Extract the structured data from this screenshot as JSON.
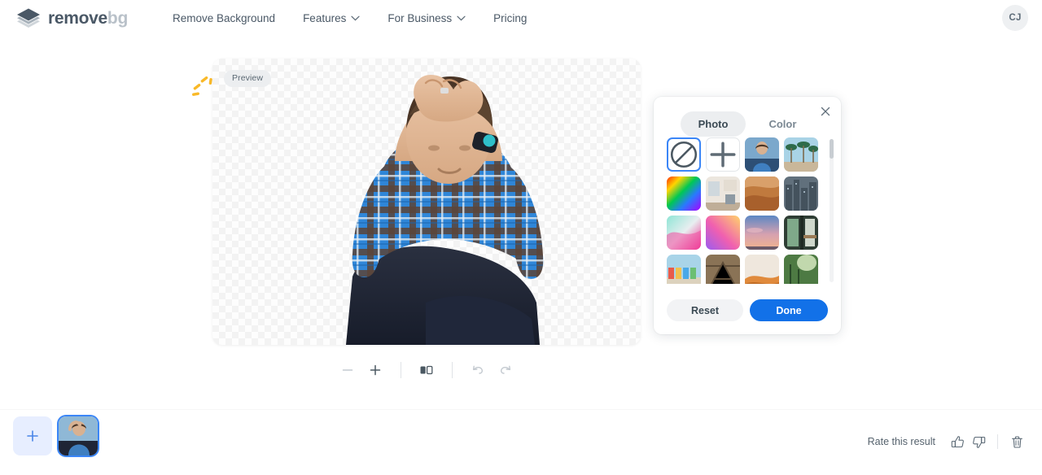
{
  "header": {
    "logo": {
      "icon": "layers-diamond-logo",
      "text_primary": "remove",
      "text_secondary": "bg"
    },
    "nav": [
      {
        "label": "Remove Background",
        "has_chevron": false,
        "icon": ""
      },
      {
        "label": "Features",
        "has_chevron": true,
        "icon": "chevron-down-icon"
      },
      {
        "label": "For Business",
        "has_chevron": true,
        "icon": "chevron-down-icon"
      },
      {
        "label": "Pricing",
        "has_chevron": false,
        "icon": ""
      }
    ],
    "avatar_initials": "CJ"
  },
  "canvas": {
    "preview_badge": "Preview",
    "sparkle_icon": "sparkle-decoration",
    "subject_alt": "man-sitting-hands-on-head-plaid-shirt"
  },
  "toolbar": {
    "zoom_out": {
      "icon": "minus-icon",
      "label": "Zoom out",
      "disabled": true
    },
    "zoom_in": {
      "icon": "plus-icon",
      "label": "Zoom in",
      "disabled": false
    },
    "compare": {
      "icon": "split-compare-icon",
      "label": "Compare",
      "disabled": false
    },
    "undo": {
      "icon": "undo-icon",
      "label": "Undo",
      "disabled": true
    },
    "redo": {
      "icon": "redo-icon",
      "label": "Redo",
      "disabled": true
    }
  },
  "background_panel": {
    "close_icon": "close-icon",
    "tabs": [
      {
        "label": "Photo",
        "active": true
      },
      {
        "label": "Color",
        "active": false
      }
    ],
    "thumbnails": [
      {
        "kind": "none",
        "name": "no-background",
        "icon": "no-background-icon"
      },
      {
        "kind": "add",
        "name": "upload-background",
        "icon": "plus-icon"
      },
      {
        "kind": "photo",
        "name": "photo-man-portrait"
      },
      {
        "kind": "photo",
        "name": "photo-palm-trees"
      },
      {
        "kind": "gradient",
        "name": "gradient-rainbow"
      },
      {
        "kind": "photo",
        "name": "photo-interior-room"
      },
      {
        "kind": "photo",
        "name": "photo-desert-dunes"
      },
      {
        "kind": "photo",
        "name": "photo-city-skyline"
      },
      {
        "kind": "gradient",
        "name": "gradient-teal-pink"
      },
      {
        "kind": "gradient",
        "name": "gradient-purple-yellow"
      },
      {
        "kind": "photo",
        "name": "photo-sunset-sky"
      },
      {
        "kind": "photo",
        "name": "photo-balcony-window"
      },
      {
        "kind": "photo",
        "name": "photo-beach-huts"
      },
      {
        "kind": "photo",
        "name": "photo-wooden-structure"
      },
      {
        "kind": "photo",
        "name": "photo-orange-dune"
      },
      {
        "kind": "photo",
        "name": "photo-forest-light"
      }
    ],
    "reset_label": "Reset",
    "done_label": "Done"
  },
  "bottom_bar": {
    "add_image_icon": "plus-icon",
    "filmstrip_thumb": "thumb-man-sitting",
    "rate_label": "Rate this result",
    "thumbs_up_icon": "thumbs-up-icon",
    "thumbs_down_icon": "thumbs-down-icon",
    "delete_icon": "trash-icon"
  },
  "colors": {
    "accent_blue": "#1271e8",
    "selection_blue": "#3b86f7",
    "text_dark": "#3b4a54",
    "text_muted": "#7b8893",
    "panel_gray": "#eceef0",
    "sparkle_yellow": "#f9b928"
  }
}
